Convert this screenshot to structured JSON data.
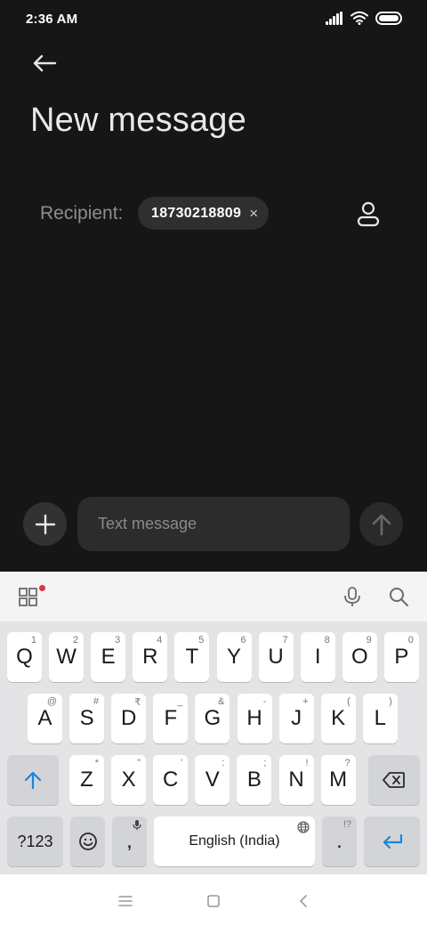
{
  "status_bar": {
    "time": "2:36 AM",
    "icons": [
      "signal-icon",
      "wifi-icon",
      "battery-icon"
    ]
  },
  "header": {
    "back_icon": "arrow-left-icon",
    "title": "New message"
  },
  "recipient": {
    "label": "Recipient:",
    "chip_value": "18730218809",
    "chip_remove_symbol": "×",
    "contacts_icon": "person-icon"
  },
  "compose": {
    "add_icon": "plus-icon",
    "placeholder": "Text message",
    "value": "",
    "send_icon": "arrow-up-icon"
  },
  "keyboard": {
    "toolbar_icons": [
      "apps-grid-icon",
      "microphone-icon",
      "search-icon"
    ],
    "rows": [
      [
        {
          "label": "Q",
          "sub": "1"
        },
        {
          "label": "W",
          "sub": "2"
        },
        {
          "label": "E",
          "sub": "3"
        },
        {
          "label": "R",
          "sub": "4"
        },
        {
          "label": "T",
          "sub": "5"
        },
        {
          "label": "Y",
          "sub": "6"
        },
        {
          "label": "U",
          "sub": "7"
        },
        {
          "label": "I",
          "sub": "8"
        },
        {
          "label": "O",
          "sub": "9"
        },
        {
          "label": "P",
          "sub": "0"
        }
      ],
      [
        {
          "label": "A",
          "sub": "@"
        },
        {
          "label": "S",
          "sub": "#"
        },
        {
          "label": "D",
          "sub": "₹"
        },
        {
          "label": "F",
          "sub": "_"
        },
        {
          "label": "G",
          "sub": "&"
        },
        {
          "label": "H",
          "sub": "-"
        },
        {
          "label": "J",
          "sub": "+"
        },
        {
          "label": "K",
          "sub": "("
        },
        {
          "label": "L",
          "sub": ")"
        }
      ],
      [
        {
          "label": "Z",
          "sub": "*"
        },
        {
          "label": "X",
          "sub": "\""
        },
        {
          "label": "C",
          "sub": "'"
        },
        {
          "label": "V",
          "sub": ":"
        },
        {
          "label": "B",
          "sub": ";"
        },
        {
          "label": "N",
          "sub": "!"
        },
        {
          "label": "M",
          "sub": "?"
        }
      ]
    ],
    "shift_icon": "shift-arrow-icon",
    "backspace_icon": "backspace-icon",
    "symbols_label": "?123",
    "emoji_icon": "emoji-icon",
    "comma_label": ",",
    "space_label": "English (India)",
    "period_label": ".",
    "period_sub": "!?",
    "enter_icon": "enter-icon"
  },
  "nav_bar": {
    "icons": [
      "menu-icon",
      "home-square-icon",
      "back-chevron-icon"
    ]
  },
  "colors": {
    "background": "#161616",
    "accent": "#1a86d6",
    "notification_dot": "#e2343f"
  }
}
